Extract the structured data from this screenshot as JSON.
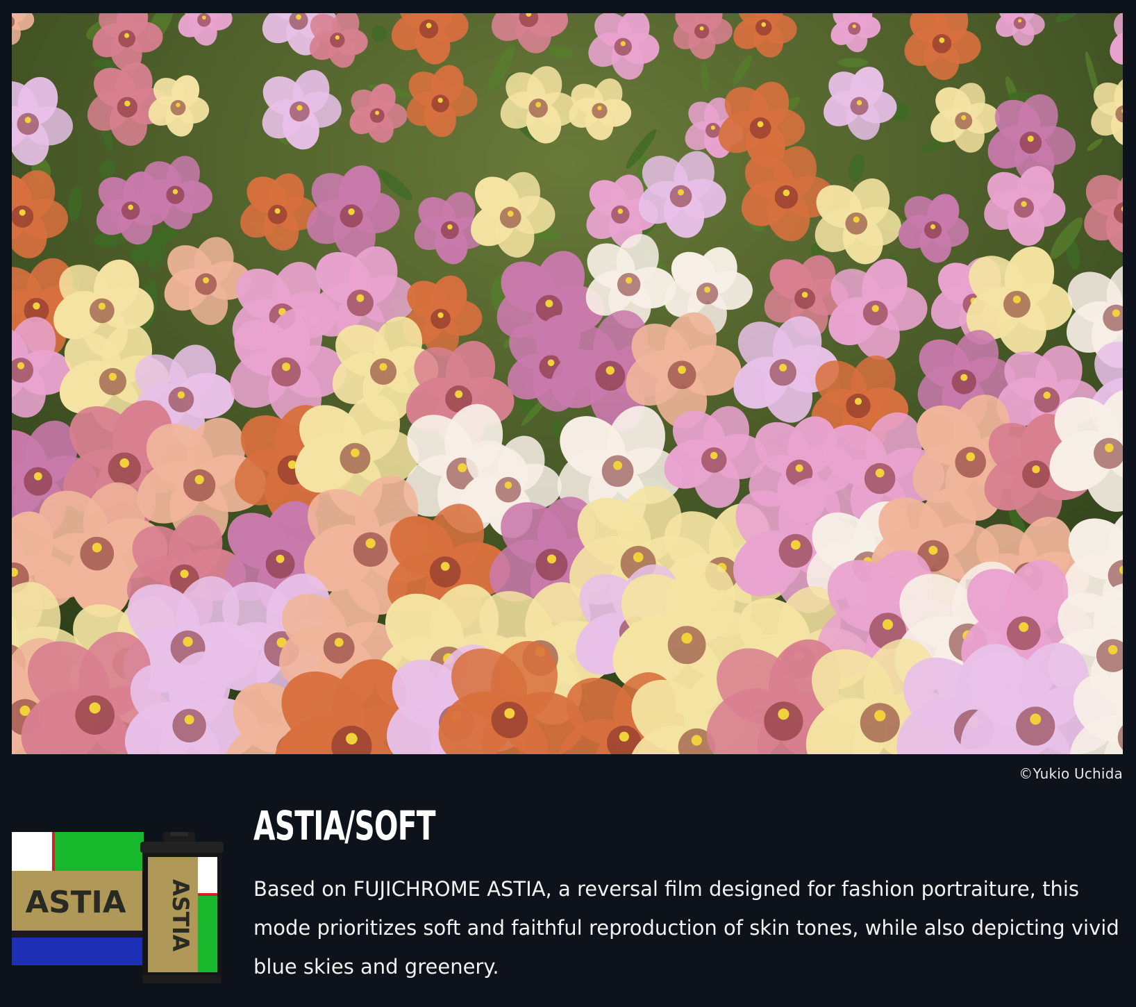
{
  "photo": {
    "subject": "field-of-pansies",
    "palette": [
      "#e8a0c8",
      "#d9713a",
      "#f3e2a0",
      "#c77aa8",
      "#3c5a22",
      "#f5f0f0"
    ]
  },
  "credit": {
    "text": "©Yukio Uchida"
  },
  "film_logo": {
    "box_label": "ASTIA",
    "canister_label": "ASTIA",
    "colors": {
      "green": "#17b82c",
      "blue": "#1d2fb4",
      "gold": "#b09858",
      "red": "#d42020",
      "white": "#ffffff",
      "dark": "#1a1a1a"
    }
  },
  "mode": {
    "title": "ASTIA/SOFT",
    "description": "Based on FUJICHROME ASTIA, a reversal film designed for fashion portraiture, this mode prioritizes soft and faithful reproduction of skin tones, while also depicting vivid blue skies and greenery."
  }
}
